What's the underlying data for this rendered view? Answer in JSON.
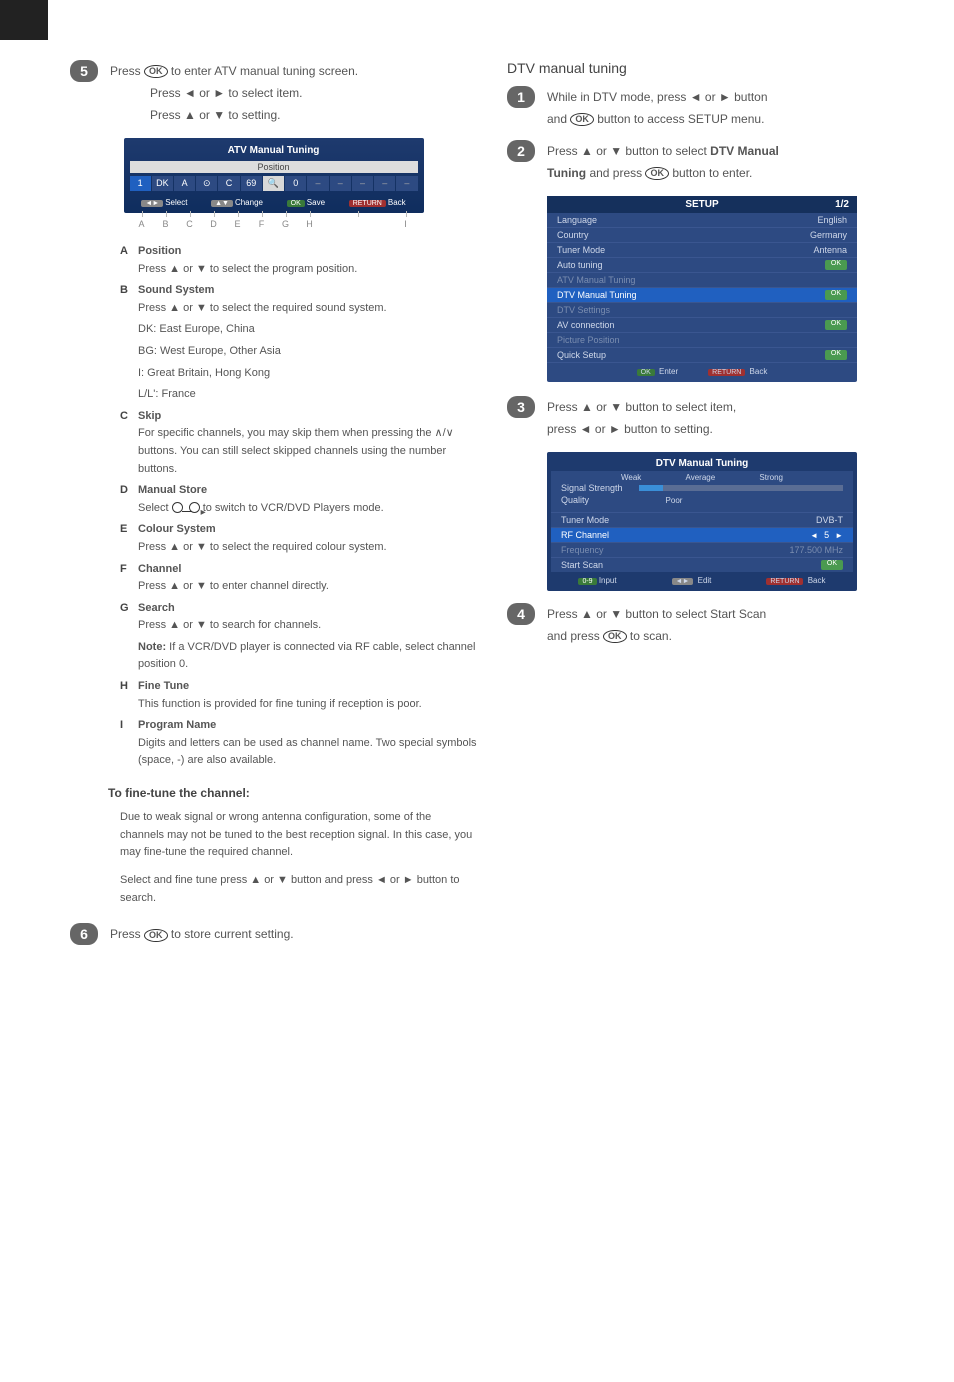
{
  "left": {
    "step5": {
      "line1_prefix": "Press ",
      "line1_suffix": " to enter ATV manual tuning screen.",
      "line2": "Press ◄ or ► to select item.",
      "line3": "Press ▲ or ▼ to setting."
    },
    "atv_panel": {
      "title": "ATV Manual Tuning",
      "subtitle": "Position",
      "cells": [
        "1",
        "DK",
        "A",
        "⊙",
        "C",
        "69",
        "🔍",
        "0",
        "–",
        "–",
        "–",
        "–",
        "–"
      ],
      "hints": {
        "select_key": "◄►",
        "select": "Select",
        "change_key": "▲▼",
        "change": "Change",
        "save_key": "OK",
        "save": "Save",
        "back_key": "RETURN",
        "back": "Back"
      },
      "letters": [
        "A",
        "B",
        "C",
        "D",
        "E",
        "F",
        "G",
        "H",
        "",
        "I"
      ]
    },
    "expl": {
      "A": {
        "label": "A",
        "title": "Position",
        "body": "Press ▲ or ▼ to select the program position."
      },
      "B": {
        "label": "B",
        "title": "Sound System",
        "body1": "Press ▲ or ▼ to select the required sound system.",
        "body2": "DK: East Europe, China",
        "body3": "BG: West Europe, Other Asia",
        "body4": "I: Great Britain, Hong Kong",
        "body5": "L/L': France"
      },
      "C": {
        "label": "C",
        "title": "Skip",
        "body": "For specific channels, you may skip them when pressing the ∧/∨ buttons. You can still select skipped channels using the number buttons."
      },
      "D": {
        "label": "D",
        "title": "Manual Store",
        "body_pre": "Select ",
        "body_post": " to switch to VCR/DVD Players mode."
      },
      "E": {
        "label": "E",
        "title": "Colour System",
        "body": "Press ▲ or ▼ to select the required colour system."
      },
      "F": {
        "label": "F",
        "title": "Channel",
        "body": "Press ▲ or ▼ to enter channel directly."
      },
      "G": {
        "label": "G",
        "title": "Search",
        "body": "Press ▲ or ▼ to search for channels.",
        "note_title": "Note:",
        "note_body": "If a VCR/DVD player is connected via RF cable, select channel position 0."
      },
      "H": {
        "label": "H",
        "title": "Fine Tune",
        "body": "This function is provided for fine tuning if reception is poor."
      },
      "I": {
        "label": "I",
        "title": "Program Name",
        "body": "Digits and letters can be used as channel name. Two special symbols (space, -) are also available."
      }
    },
    "fine_tuning": {
      "head": "To fine-tune the channel:",
      "p1": "Due to weak signal or wrong antenna configuration, some of the channels may not be tuned to the best reception signal. In this case, you may fine-tune the required channel.",
      "p2": "Select and fine tune press ▲ or ▼ button and press ◄ or ► button to search."
    },
    "step6": {
      "prefix": "Press ",
      "suffix": " to store current setting."
    }
  },
  "right": {
    "dtv_head": "DTV manual tuning",
    "step1": {
      "l1": "While in DTV mode, press ◄ or ► button",
      "l2_pre": "and ",
      "l2_suf": " button to access SETUP menu."
    },
    "step2": {
      "l1": "Press ▲ or ▼ button to select ",
      "l1_bold": "DTV Manual",
      "l2_bold": "Tuning",
      "l2_pre": " and press ",
      "l2_suf": " button to enter."
    },
    "setup_panel": {
      "title": "SETUP",
      "page": "1/2",
      "rows": [
        {
          "label": "Language",
          "value": "English"
        },
        {
          "label": "Country",
          "value": "Germany"
        },
        {
          "label": "Tuner Mode",
          "value": "Antenna"
        },
        {
          "label": "Auto tuning",
          "value_type": "ok"
        },
        {
          "label": "ATV Manual Tuning",
          "dim": true
        },
        {
          "label": "DTV Manual Tuning",
          "value_type": "ok",
          "hi": true
        },
        {
          "label": "DTV Settings",
          "dim": true
        },
        {
          "label": "AV connection",
          "value_type": "ok"
        },
        {
          "label": "Picture Position",
          "dim": true
        },
        {
          "label": "Quick Setup",
          "value_type": "ok"
        }
      ],
      "hints": {
        "enter_key": "OK",
        "enter": "Enter",
        "back_key": "RETURN",
        "back": "Back"
      }
    },
    "step3": {
      "l1": "Press ▲ or ▼ button to select item,",
      "l2": "press ◄ or ► button to setting."
    },
    "dtv_panel": {
      "title": "DTV Manual Tuning",
      "scale": {
        "weak": "Weak",
        "avg": "Average",
        "strong": "Strong"
      },
      "signal_label": "Signal Strength",
      "quality_label": "Quality",
      "quality_value": "Poor",
      "rows": {
        "tuner": {
          "label": "Tuner Mode",
          "value": "DVB-T"
        },
        "rf": {
          "label": "RF Channel",
          "value": "5"
        },
        "freq": {
          "label": "Frequency",
          "value": "177.500 MHz"
        },
        "start": {
          "label": "Start Scan",
          "value_type": "ok"
        }
      },
      "hints": {
        "input_key": "0-9",
        "input": "Input",
        "edit_key": "◄►",
        "edit": "Edit",
        "back_key": "RETURN",
        "back": "Back"
      }
    },
    "step4": {
      "l1": "Press ▲ or ▼ button to select Start Scan",
      "l2_pre": "and press ",
      "l2_suf": " to scan."
    }
  }
}
